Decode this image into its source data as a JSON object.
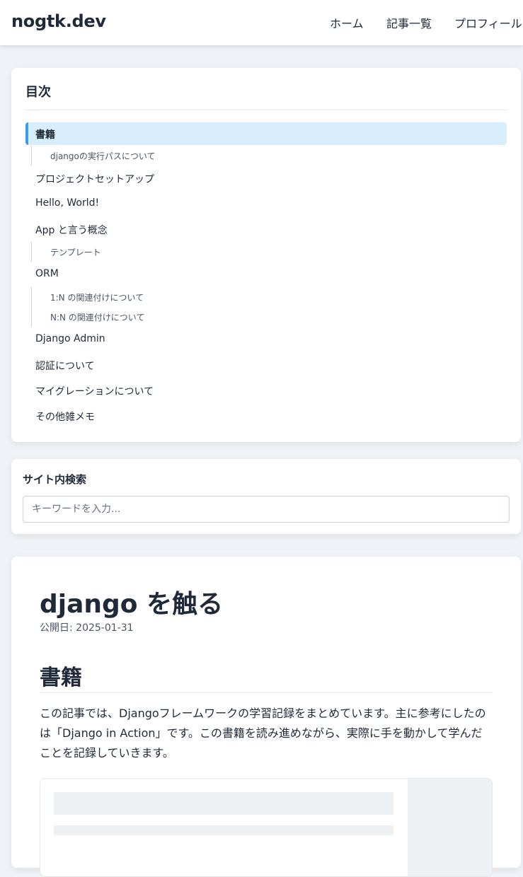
{
  "header": {
    "logo": "nogtk.dev",
    "nav": [
      "ホーム",
      "記事一覧",
      "プロフィール"
    ]
  },
  "toc": {
    "title": "目次",
    "active_item": "書籍",
    "items": [
      {
        "label": "書籍",
        "level": 1,
        "active": true
      },
      {
        "label": "djangoの実行パスについて",
        "level": 2
      },
      {
        "label": "プロジェクトセットアップ",
        "level": 1
      },
      {
        "label": "Hello, World!",
        "level": 1
      },
      {
        "label": "App と言う概念",
        "level": 1
      },
      {
        "label": "テンプレート",
        "level": 2
      },
      {
        "label": "ORM",
        "level": 1
      },
      {
        "label": "1:N の関連付けについて",
        "level": 2
      },
      {
        "label": "N:N の関連付けについて",
        "level": 2
      },
      {
        "label": "Django Admin",
        "level": 1
      },
      {
        "label": "認証について",
        "level": 1
      },
      {
        "label": "マイグレーションについて",
        "level": 1
      },
      {
        "label": "その他雑メモ",
        "level": 1
      }
    ]
  },
  "search": {
    "title": "サイト内検索",
    "placeholder": "キーワードを入力..."
  },
  "article": {
    "title": "django を触る",
    "date": "公開日: 2025-01-31",
    "section_heading": "書籍",
    "body": "この記事では、Djangoフレームワークの学習記録をまとめています。主に参考にしたのは「Django in Action」です。この書籍を読み進めながら、実際に手を動かして学んだことを記録していきます。"
  },
  "colors": {
    "background": "#eff2f6",
    "card": "#ffffff",
    "text": "#1f2937",
    "toc_active_bg": "#d9eefc",
    "toc_active_accent": "#3b9de8"
  }
}
